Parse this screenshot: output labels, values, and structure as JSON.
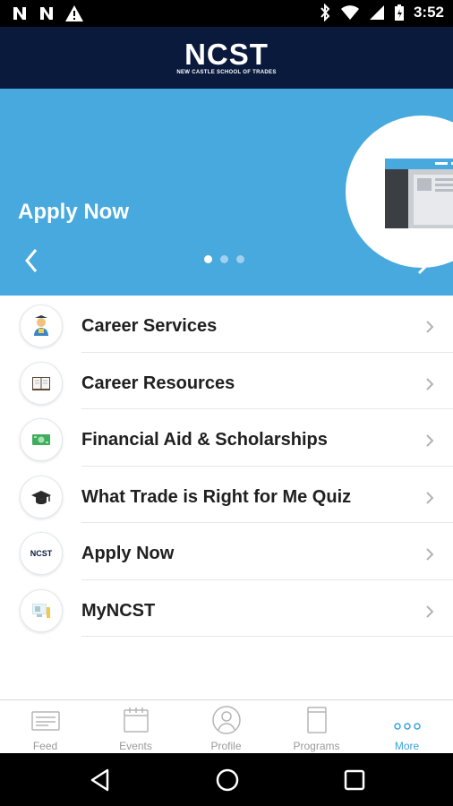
{
  "status_bar": {
    "time": "3:52",
    "left_icons": [
      "notification-n-icon",
      "notification-n-icon",
      "warning-icon"
    ],
    "right_icons": [
      "bluetooth-icon",
      "wifi-icon",
      "signal-icon",
      "battery-icon"
    ]
  },
  "header": {
    "logo_text": "NCST",
    "logo_subtitle": "NEW CASTLE SCHOOL OF TRADES"
  },
  "banner": {
    "title": "Apply Now",
    "dots": 3,
    "active_dot": 0,
    "background_color": "#47a9dd"
  },
  "menu": {
    "items": [
      {
        "label": "Career Services",
        "icon": "graduate-icon"
      },
      {
        "label": "Career Resources",
        "icon": "book-icon"
      },
      {
        "label": "Financial Aid & Scholarships",
        "icon": "money-icon"
      },
      {
        "label": "What Trade is Right for Me Quiz",
        "icon": "graduation-cap-icon"
      },
      {
        "label": "Apply Now",
        "icon": "ncst-logo-icon",
        "icon_text": "NCST"
      },
      {
        "label": "MyNCST",
        "icon": "computer-icon"
      }
    ]
  },
  "tab_bar": {
    "tabs": [
      {
        "label": "Feed",
        "icon": "feed-icon"
      },
      {
        "label": "Events",
        "icon": "calendar-icon"
      },
      {
        "label": "Profile",
        "icon": "profile-icon"
      },
      {
        "label": "Programs",
        "icon": "document-icon"
      },
      {
        "label": "More",
        "icon": "more-icon"
      }
    ],
    "active": "More",
    "active_color": "#3aa4de"
  },
  "nav_bar": {
    "buttons": [
      "back-icon",
      "home-icon",
      "recents-icon"
    ]
  }
}
